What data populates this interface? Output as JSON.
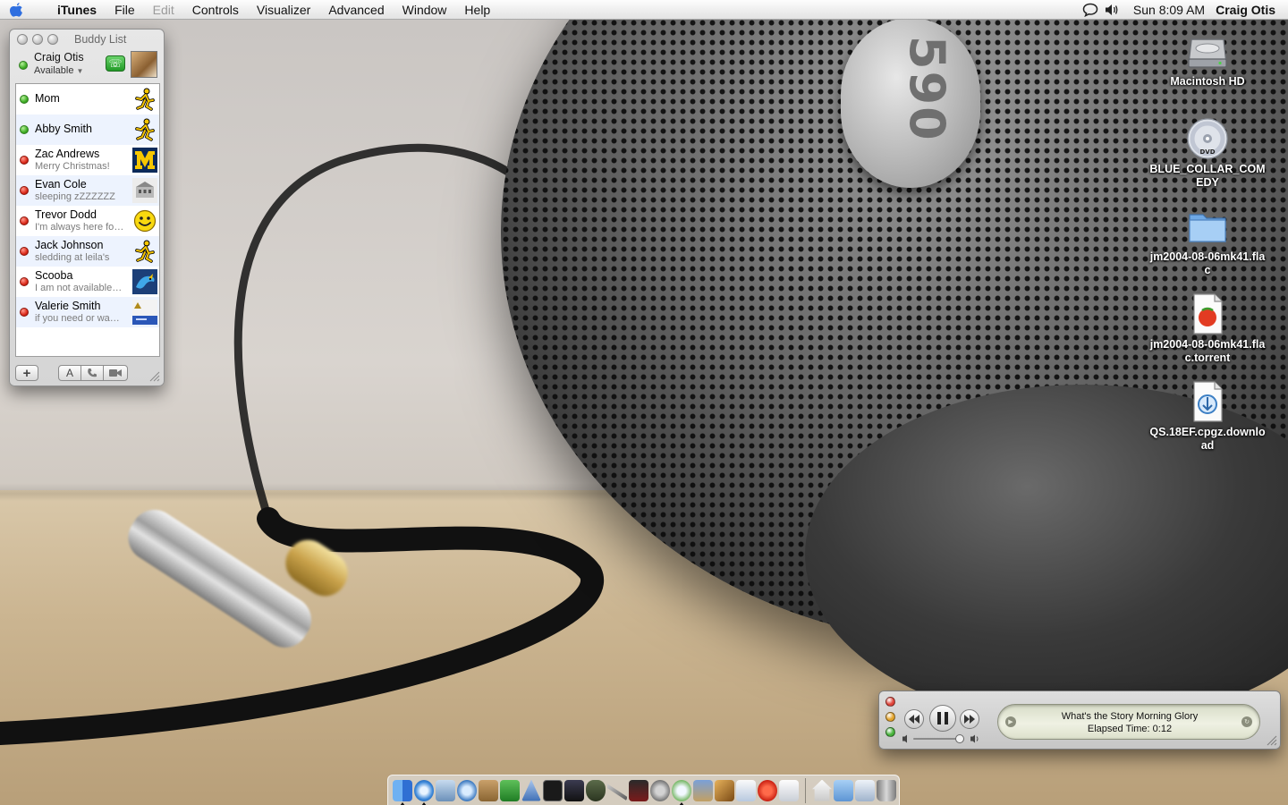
{
  "menubar": {
    "app_name": "iTunes",
    "items": [
      {
        "label": "File",
        "enabled": true
      },
      {
        "label": "Edit",
        "enabled": false
      },
      {
        "label": "Controls",
        "enabled": true
      },
      {
        "label": "Visualizer",
        "enabled": true
      },
      {
        "label": "Advanced",
        "enabled": true
      },
      {
        "label": "Window",
        "enabled": true
      },
      {
        "label": "Help",
        "enabled": true
      }
    ],
    "status_icons": [
      "ichat-bubble-icon",
      "volume-icon"
    ],
    "clock": "Sun 8:09 AM",
    "user": "Craig Otis"
  },
  "buddy_list": {
    "title": "Buddy List",
    "me": {
      "name": "Craig Otis",
      "status": "Available",
      "status_color": "green"
    },
    "buddies": [
      {
        "name": "Mom",
        "message": "",
        "status": "green",
        "icon": "aim-running-man-icon"
      },
      {
        "name": "Abby Smith",
        "message": "",
        "status": "green",
        "icon": "aim-running-man-icon"
      },
      {
        "name": "Zac Andrews",
        "message": "Merry Christmas!",
        "status": "red",
        "icon": "michigan-m-icon"
      },
      {
        "name": "Evan Cole",
        "message": "sleeping zZZZZZZ",
        "status": "red",
        "icon": "building-icon"
      },
      {
        "name": "Trevor Dodd",
        "message": "I'm always here for you",
        "status": "red",
        "icon": "smiley-face-icon"
      },
      {
        "name": "Jack Johnson",
        "message": "sledding at leila's",
        "status": "red",
        "icon": "aim-running-man-icon"
      },
      {
        "name": "Scooba",
        "message": "I am not available right now",
        "status": "red",
        "icon": "blue-bird-icon"
      },
      {
        "name": "Valerie Smith",
        "message": "if you need or want me",
        "status": "red",
        "icon": "pixel-scene-icon"
      }
    ],
    "toolbar": {
      "add_label": "+",
      "text_label": "A"
    }
  },
  "desktop_icons": [
    {
      "label": "Macintosh HD",
      "icon": "hard-drive-icon"
    },
    {
      "label": "BLUE_COLLAR_COMEDY",
      "icon": "dvd-icon"
    },
    {
      "label": "jm2004-08-06mk41.flac",
      "icon": "folder-icon"
    },
    {
      "label": "jm2004-08-06mk41.flac.torrent",
      "icon": "torrent-document-icon"
    },
    {
      "label": "QS.18EF.cpgz.download",
      "icon": "download-document-icon"
    }
  ],
  "wallpaper": {
    "badge_text": "590"
  },
  "itunes_mini": {
    "song": "What's the Story Morning Glory",
    "elapsed": "Elapsed Time: 0:12",
    "colors": {
      "close": "#e0443a",
      "minimize": "#e3a32a",
      "zoom": "#48b33c"
    }
  },
  "dock": {
    "left_items": [
      "finder-icon",
      "safari-icon",
      "mail-icon",
      "sherlock-icon",
      "address-book-icon",
      "ical-icon",
      "preview-icon",
      "terminal-icon",
      "activity-monitor-icon",
      "shield-icon",
      "scissors-icon",
      "army-icon",
      "system-preferences-icon",
      "itunes-icon",
      "iphoto-icon",
      "garageband-icon",
      "text-edit-icon",
      "tomato-icon",
      "preview-image-icon"
    ],
    "right_items": [
      "home-folder-icon",
      "documents-folder-icon",
      "mail-downloads-icon",
      "trash-icon"
    ],
    "running": [
      0,
      1,
      13
    ]
  }
}
